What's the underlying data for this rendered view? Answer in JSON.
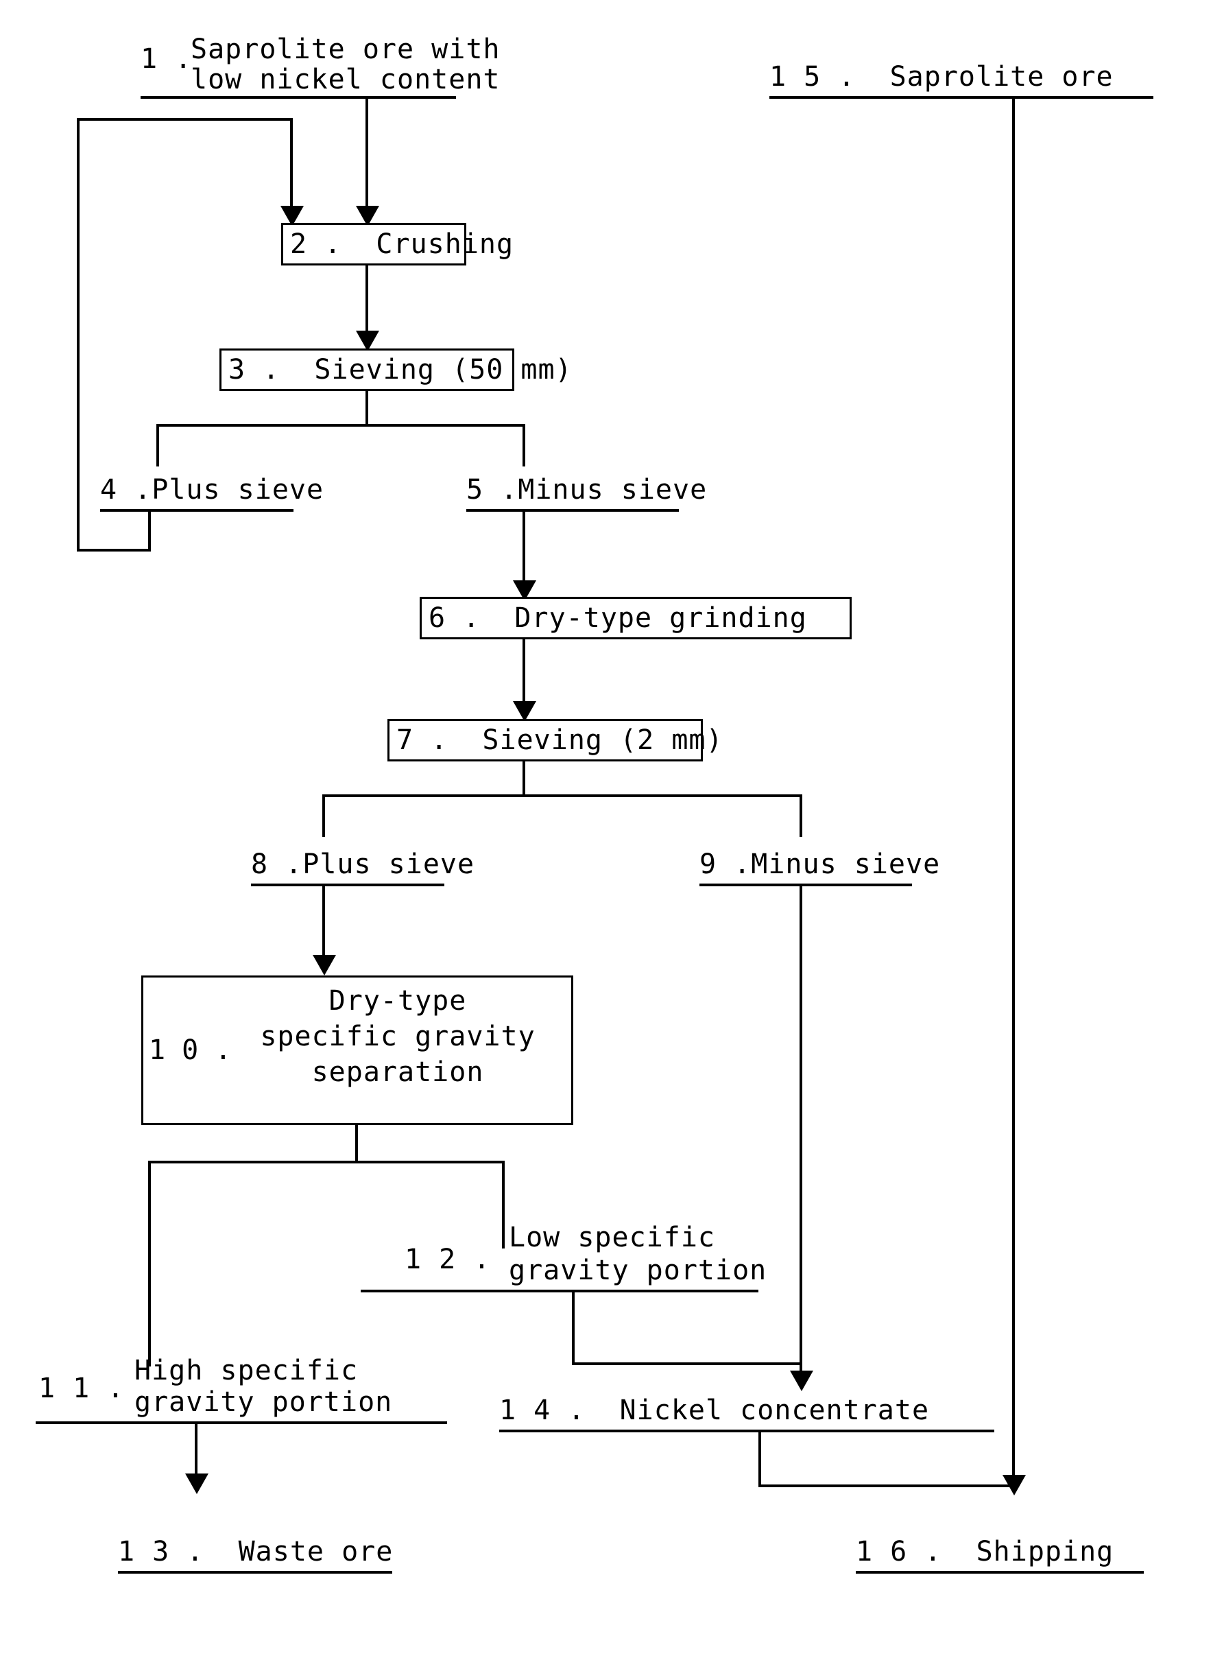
{
  "diagram": {
    "title": "Nickel saprolite ore beneficiation process flow",
    "nodes": {
      "n1": {
        "number": "1 .",
        "line1": "Saprolite ore with",
        "line2": "low nickel content"
      },
      "n2": {
        "text": "2 .  Crushing"
      },
      "n3": {
        "text": "3 .  Sieving (50 mm)"
      },
      "n4": {
        "text": "4 .Plus sieve"
      },
      "n5": {
        "text": "5 .Minus sieve"
      },
      "n6": {
        "text": "6 .  Dry-type grinding"
      },
      "n7": {
        "text": "7 .  Sieving (2 mm)"
      },
      "n8": {
        "text": "8 .Plus sieve"
      },
      "n9": {
        "text": "9 .Minus sieve"
      },
      "n10": {
        "number": "1 0 .",
        "line1": "Dry-type",
        "line2": "specific gravity",
        "line3": "separation"
      },
      "n11": {
        "number": "1 1 .",
        "line1": "High specific",
        "line2": "gravity portion"
      },
      "n12": {
        "number": "1 2 .",
        "line1": "Low specific",
        "line2": "gravity portion"
      },
      "n13": {
        "text": "1 3 .  Waste ore"
      },
      "n14": {
        "text": "1 4 .  Nickel concentrate"
      },
      "n15": {
        "text": "1 5 .  Saprolite ore"
      },
      "n16": {
        "text": "1 6 .  Shipping"
      }
    },
    "colors": {
      "ink": "#000000",
      "paper": "#ffffff"
    }
  }
}
